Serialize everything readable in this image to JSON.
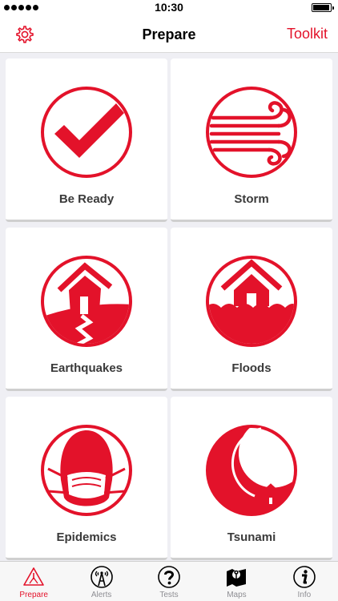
{
  "status": {
    "time": "10:30"
  },
  "nav": {
    "title": "Prepare",
    "toolkit_label": "Toolkit"
  },
  "colors": {
    "accent": "#e3122a",
    "inactive": "#8e8e93"
  },
  "cards": [
    {
      "label": "Be Ready",
      "icon": "checkmark-icon"
    },
    {
      "label": "Storm",
      "icon": "wind-icon"
    },
    {
      "label": "Earthquakes",
      "icon": "earthquake-house-icon"
    },
    {
      "label": "Floods",
      "icon": "flood-house-icon"
    },
    {
      "label": "Epidemics",
      "icon": "mask-head-icon"
    },
    {
      "label": "Tsunami",
      "icon": "wave-house-icon"
    }
  ],
  "tabs": [
    {
      "label": "Prepare",
      "icon": "warning-triangle-icon",
      "active": true
    },
    {
      "label": "Alerts",
      "icon": "radio-tower-icon",
      "active": false
    },
    {
      "label": "Tests",
      "icon": "question-icon",
      "active": false
    },
    {
      "label": "Maps",
      "icon": "map-icon",
      "active": false
    },
    {
      "label": "Info",
      "icon": "info-icon",
      "active": false
    }
  ]
}
